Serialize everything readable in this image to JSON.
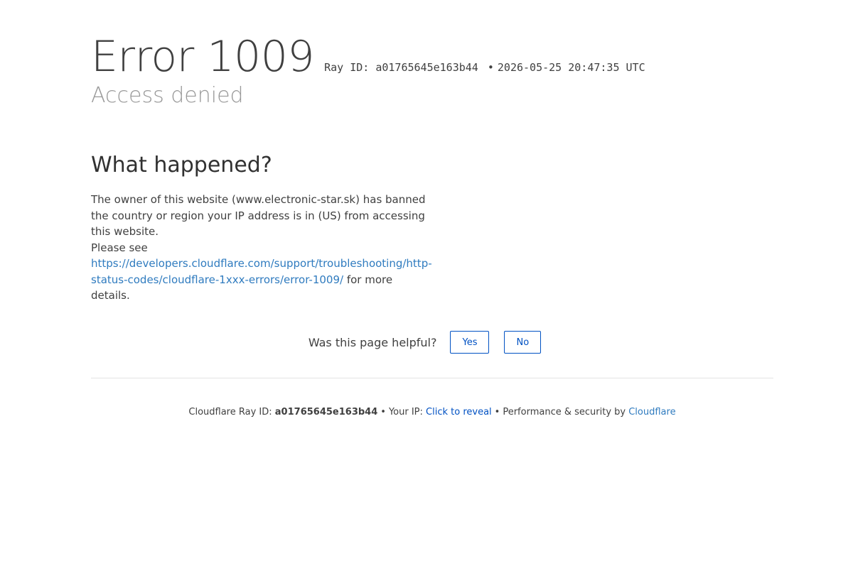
{
  "header": {
    "error_title": "Error 1009",
    "ray_label": "Ray ID: a01765645e163b44",
    "separator": "•",
    "timestamp": "2026-05-25 20:47:35 UTC",
    "subtitle": "Access denied"
  },
  "what_happened": {
    "heading": "What happened?",
    "body_text": "The owner of this website (www.electronic-star.sk) has banned the country or region your IP address is in (US) from accessing this website.",
    "please_see": "Please see",
    "link_text": "https://developers.cloudflare.com/support/troubleshooting/http-status-codes/cloudflare-1xxx-errors/error-1009/",
    "after_link": " for more details."
  },
  "feedback": {
    "question": "Was this page helpful?",
    "yes_label": "Yes",
    "no_label": "No"
  },
  "footer": {
    "ray_prefix": "Cloudflare Ray ID:",
    "ray_id": "a01765645e163b44",
    "dot": "•",
    "ip_prefix": "Your IP:",
    "reveal_label": "Click to reveal",
    "perf_text": "Performance & security by",
    "cloudflare_label": "Cloudflare"
  },
  "colors": {
    "link": "#2f7bbf",
    "button_accent": "#0051c3",
    "subtitle_gray": "#999999"
  }
}
